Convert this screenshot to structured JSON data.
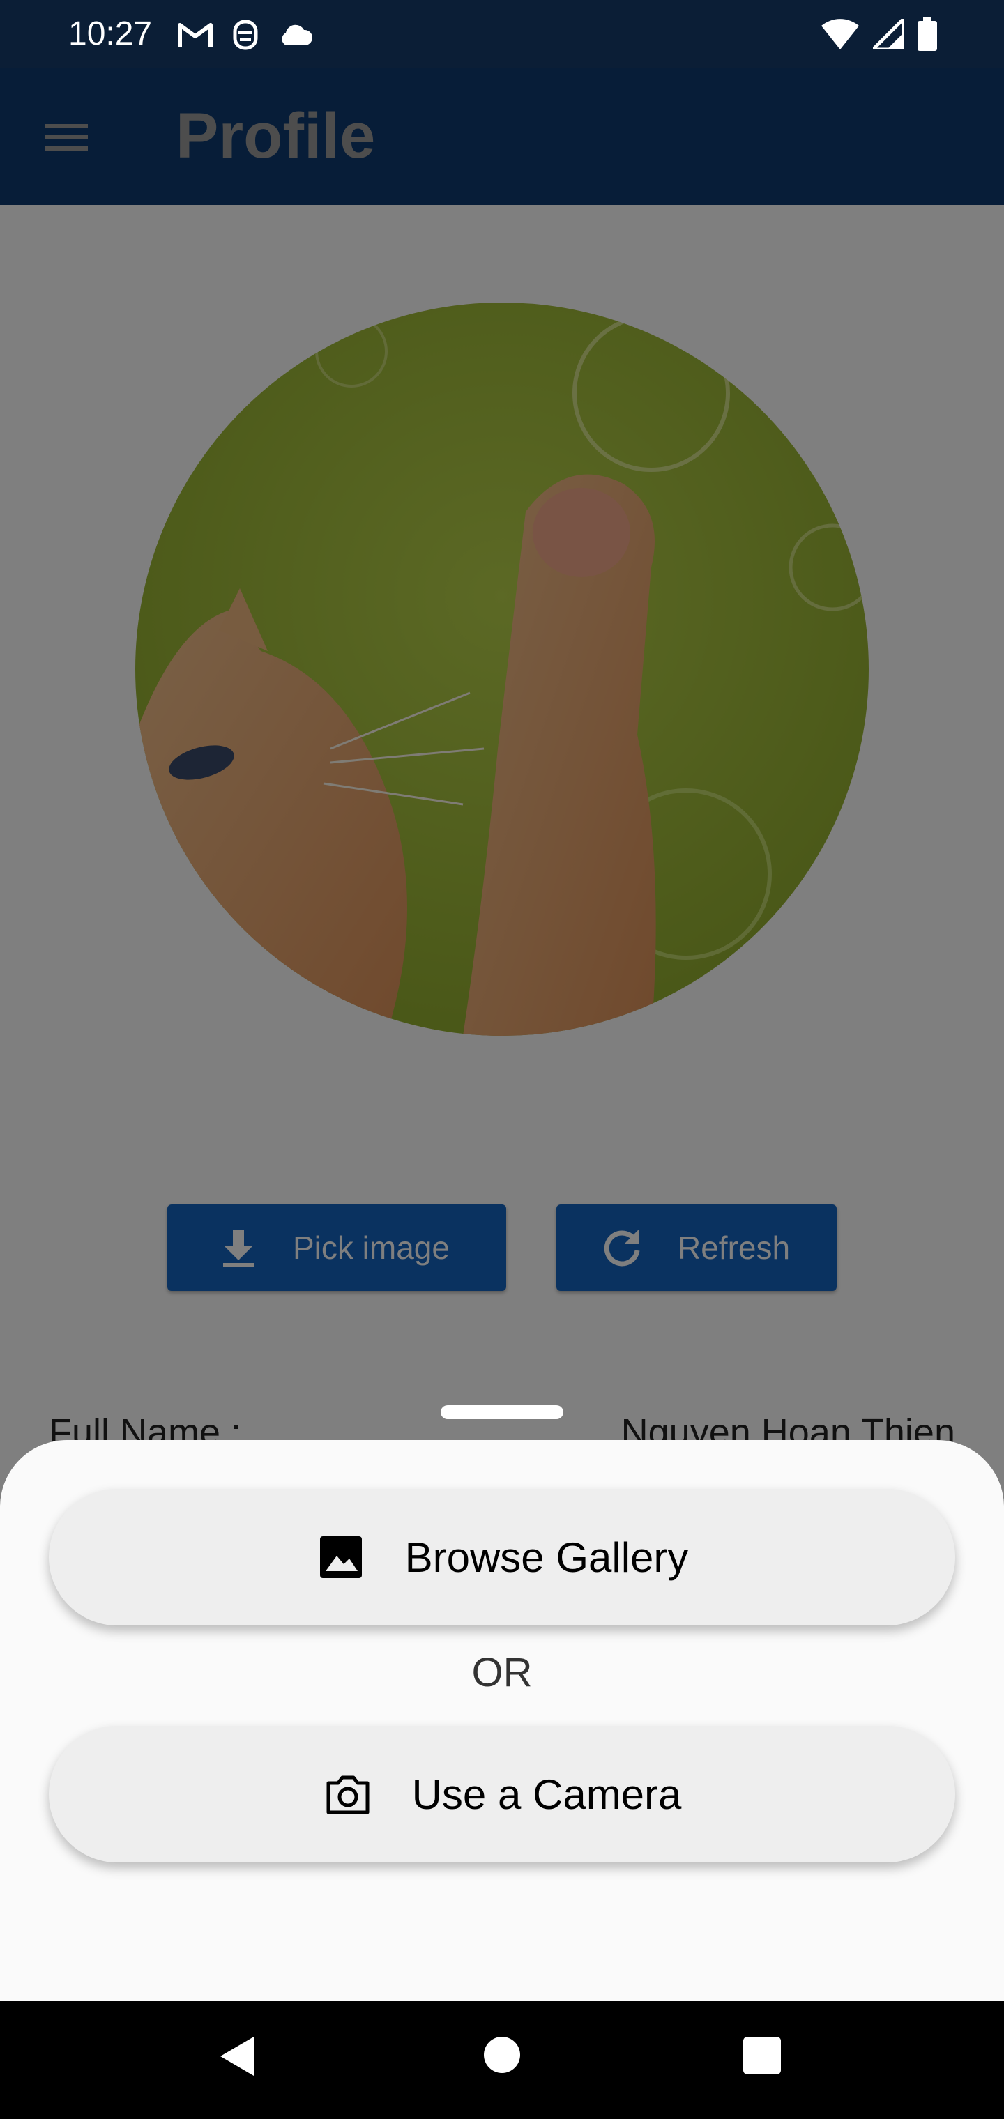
{
  "status_bar": {
    "time": "10:27",
    "left_icons": [
      "gmail-icon",
      "face-icon",
      "cloud-icon"
    ],
    "right_icons": [
      "wifi-icon",
      "signal-icon",
      "battery-icon"
    ]
  },
  "app_bar": {
    "menu_icon": "menu-icon",
    "title": "Profile"
  },
  "profile": {
    "avatar_icon": "cat-photo",
    "pick_image_label": "Pick image",
    "pick_image_icon": "download-icon",
    "refresh_label": "Refresh",
    "refresh_icon": "refresh-icon",
    "full_name_label": "Full Name :",
    "full_name_value": "Nguyen Hoan Thien"
  },
  "bottom_sheet": {
    "browse_gallery_label": "Browse Gallery",
    "browse_gallery_icon": "image-icon",
    "or_text": "OR",
    "use_camera_label": "Use a Camera",
    "use_camera_icon": "camera-icon"
  },
  "navigation": {
    "back_icon": "back-icon",
    "home_icon": "home-icon",
    "recents_icon": "recents-icon"
  },
  "colors": {
    "status_bar": "#0b1e36",
    "app_bar": "#0f3a70",
    "primary_button": "#1565c0",
    "sheet_background": "#fafafa",
    "sheet_button": "#eeeeee"
  }
}
